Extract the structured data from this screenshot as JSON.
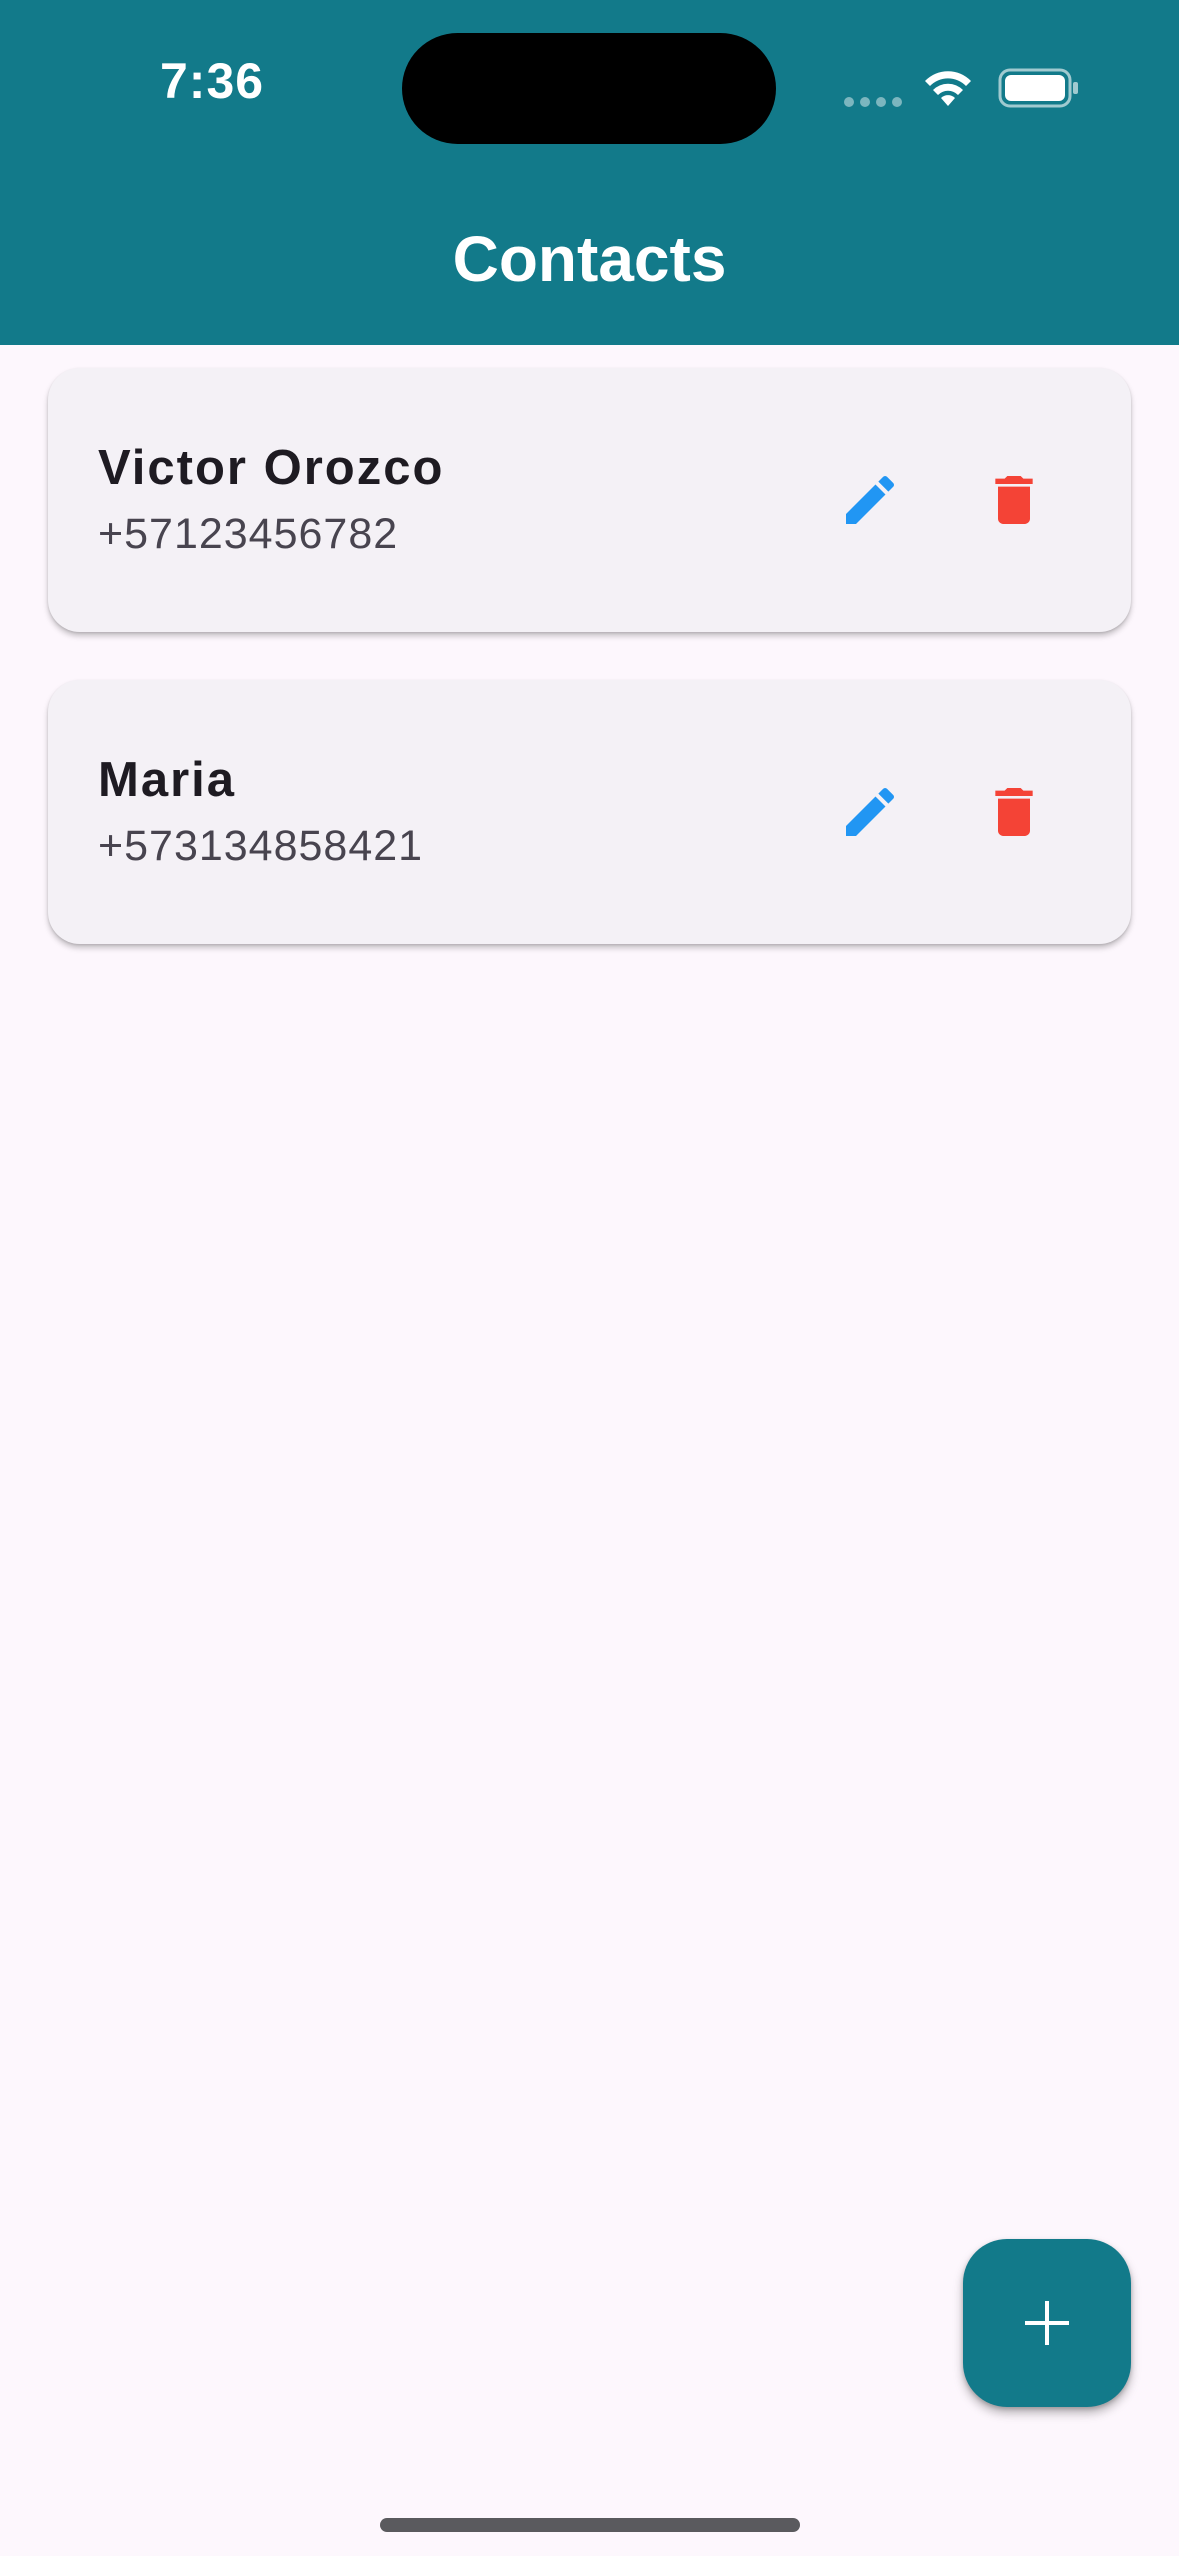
{
  "status_bar": {
    "time": "7:36",
    "icons": [
      "cellular-signal-icon",
      "wifi-icon",
      "battery-icon"
    ]
  },
  "app_bar": {
    "title": "Contacts",
    "color": "#127a8a"
  },
  "contacts": [
    {
      "name": "Victor Orozco",
      "phone": "+57123456782",
      "edit_icon": "pencil-icon",
      "delete_icon": "trash-icon"
    },
    {
      "name": "Maria",
      "phone": "+573134858421",
      "edit_icon": "pencil-icon",
      "delete_icon": "trash-icon"
    }
  ],
  "fab": {
    "icon": "plus-icon",
    "color": "#127a8a"
  },
  "colors": {
    "edit": "#2196f3",
    "delete": "#f44336",
    "background": "#fdf7fd",
    "card": "#f4f1f6"
  }
}
